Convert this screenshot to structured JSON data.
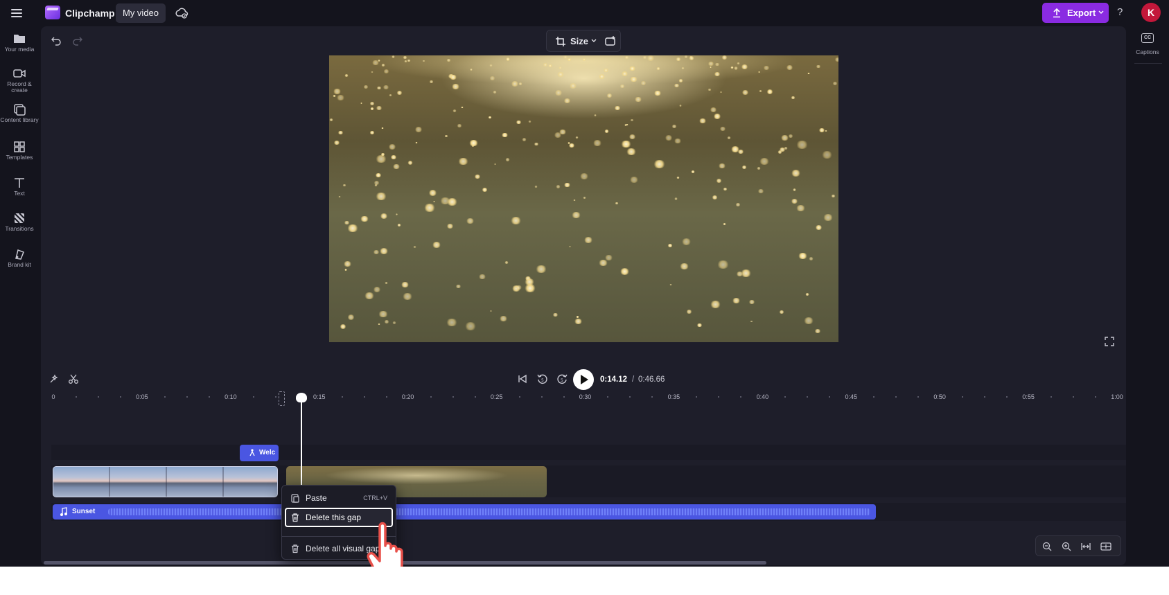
{
  "topbar": {
    "app_name": "Clipchamp",
    "project_title": "My video",
    "export_label": "Export",
    "help_label": "?",
    "avatar_initial": "K"
  },
  "sidebar": {
    "items": [
      {
        "label": "Your media",
        "icon": "folder-icon"
      },
      {
        "label": "Record & create",
        "icon": "video-camera-icon"
      },
      {
        "label": "Content library",
        "icon": "library-icon"
      },
      {
        "label": "Templates",
        "icon": "templates-icon"
      },
      {
        "label": "Text",
        "icon": "text-icon"
      },
      {
        "label": "Transitions",
        "icon": "transitions-icon"
      },
      {
        "label": "Brand kit",
        "icon": "brand-kit-icon"
      }
    ]
  },
  "right_panel": {
    "captions_label": "Captions",
    "captions_icon_text": "CC"
  },
  "preview_toolbar": {
    "size_label": "Size"
  },
  "playback": {
    "current_time": "0:14.12",
    "separator": "/",
    "total_time": "0:46.66"
  },
  "ruler": {
    "labels": [
      "0",
      "0:05",
      "0:10",
      "0:15",
      "0:20",
      "0:25",
      "0:30",
      "0:35",
      "0:40",
      "0:45",
      "0:50",
      "0:55",
      "1:00"
    ]
  },
  "timeline": {
    "text_clip_label": "Welc",
    "audio_clip_label": "Sunset"
  },
  "context_menu": {
    "items": [
      {
        "label": "Paste",
        "shortcut": "CTRL+V",
        "icon": "paste-icon"
      },
      {
        "label": "Delete this gap",
        "shortcut": "",
        "icon": "trash-icon"
      },
      {
        "label": "Delete all visual gaps",
        "shortcut": "",
        "icon": "trash-icon"
      }
    ]
  },
  "colors": {
    "app_bg": "#14141d",
    "editor_bg": "#1e1e2a",
    "accent_purple": "#8a2be2",
    "clip_blue": "#4a56e2",
    "avatar_red": "#c3173a"
  }
}
